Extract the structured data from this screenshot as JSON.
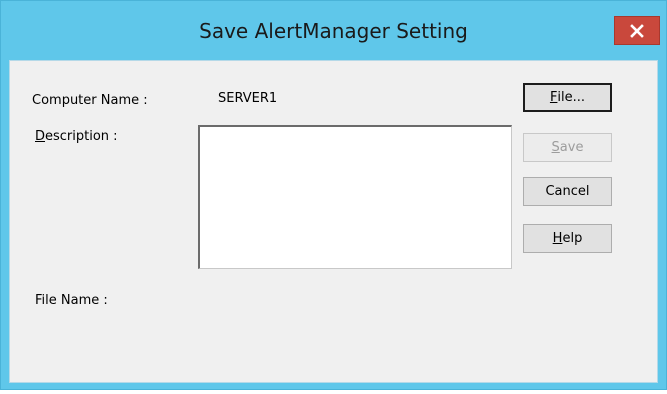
{
  "window": {
    "title": "Save AlertManager Setting",
    "close_glyph": "x"
  },
  "form": {
    "computer_name_label": "Computer Name :",
    "computer_name_value": "SERVER1",
    "description_label_mnemonic": "D",
    "description_label_rest": "escription :",
    "description_value": "",
    "file_name_label": "File Name :",
    "file_name_value": ""
  },
  "buttons": {
    "file": {
      "mnemonic": "F",
      "rest": "ile..."
    },
    "save": {
      "mnemonic": "S",
      "rest": "ave",
      "enabled": false
    },
    "cancel": {
      "label": "Cancel"
    },
    "help": {
      "mnemonic": "H",
      "rest": "elp"
    }
  },
  "colors": {
    "titlebar": "#5fc7ea",
    "close_button": "#c9483c",
    "dialog_background": "#f0f0f0"
  }
}
